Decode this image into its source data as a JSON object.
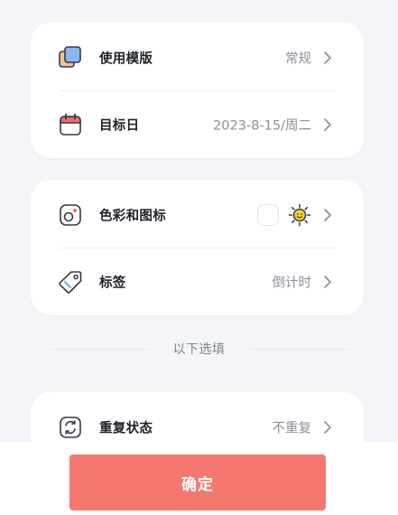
{
  "settings": {
    "template": {
      "label": "使用模版",
      "value": "常规",
      "icon": "template-icon"
    },
    "target_date": {
      "label": "目标日",
      "value": "2023-8-15/周二",
      "icon": "calendar-icon"
    },
    "color_icon": {
      "label": "色彩和图标",
      "color": "#ffffff",
      "icon": "palette-icon",
      "selected_icon": "sun-face-icon"
    },
    "tag": {
      "label": "标签",
      "value": "倒计时",
      "icon": "tag-icon"
    }
  },
  "optional_section": {
    "title": "以下选填"
  },
  "repeat": {
    "label": "重复状态",
    "value": "不重复",
    "icon": "repeat-icon"
  },
  "footer": {
    "confirm_label": "确定"
  },
  "colors": {
    "accent": "#f47870",
    "background": "#f3f5f9",
    "card": "#ffffff",
    "icon_stroke": "#33394a",
    "template_orange": "#f6c28b",
    "template_blue": "#8bb7f0",
    "calendar_red": "#f26b6b",
    "sun_yellow": "#f7d22c"
  }
}
